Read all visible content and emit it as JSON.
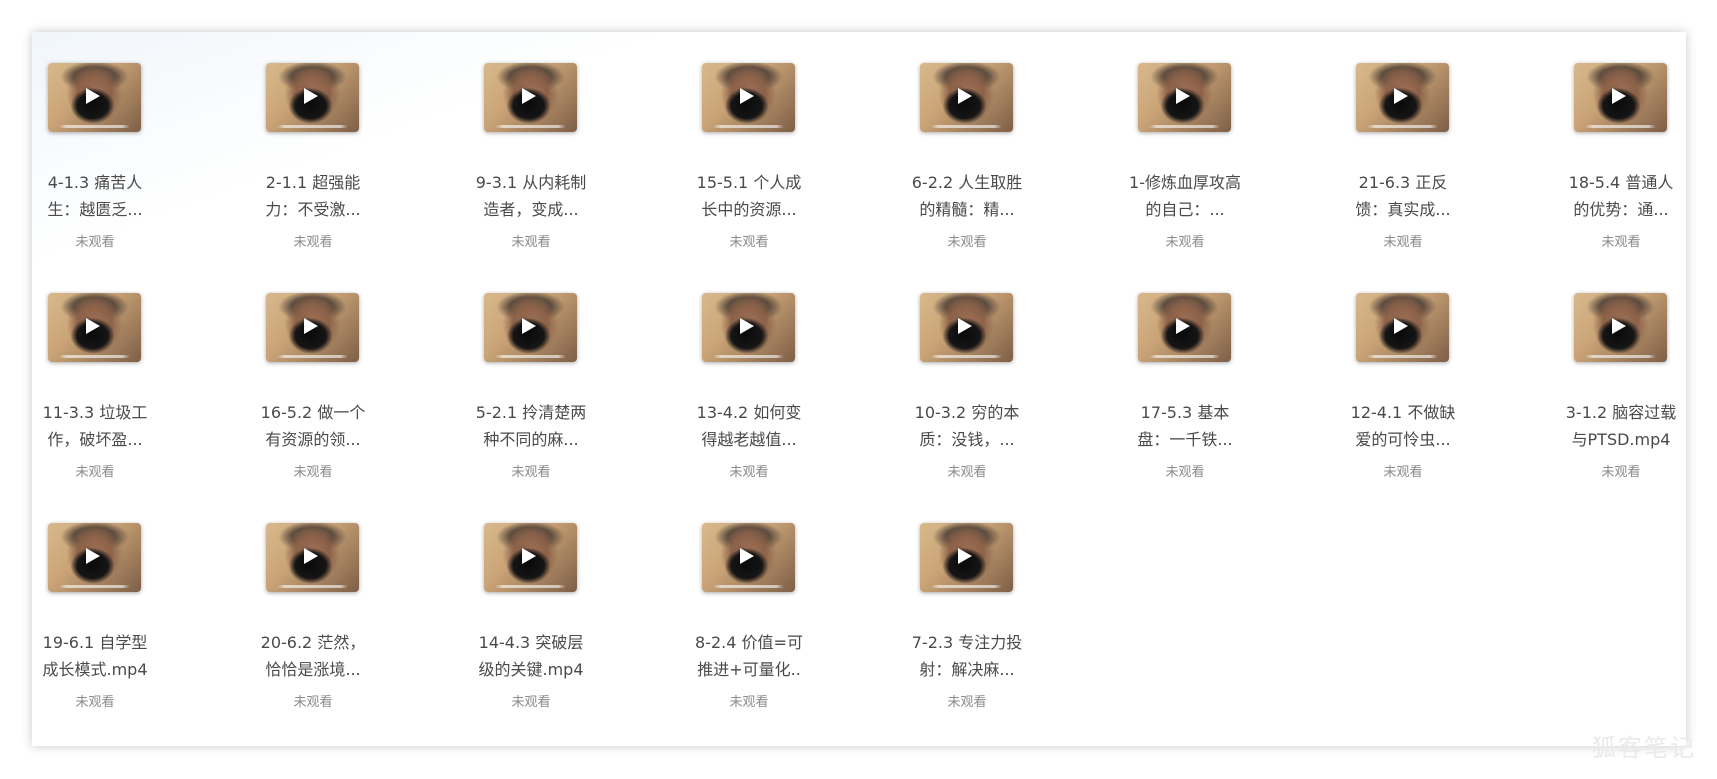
{
  "colors": {
    "title_text": "#4a4a4a",
    "status_text": "#8a8a8a",
    "panel_background": "#ffffff"
  },
  "icons": {
    "play": "play-icon"
  },
  "watermark": "狐客笔记",
  "videos": [
    {
      "title": "4-1.3 痛苦人生：越匮乏...",
      "status": "未观看"
    },
    {
      "title": "2-1.1 超强能力：不受激...",
      "status": "未观看"
    },
    {
      "title": "9-3.1 从内耗制造者，变成...",
      "status": "未观看"
    },
    {
      "title": "15-5.1 个人成长中的资源...",
      "status": "未观看"
    },
    {
      "title": "6-2.2 人生取胜的精髓：精...",
      "status": "未观看"
    },
    {
      "title": "1-修炼血厚攻高的自己：...",
      "status": "未观看"
    },
    {
      "title": "21-6.3 正反馈：真实成...",
      "status": "未观看"
    },
    {
      "title": "18-5.4 普通人的优势：通...",
      "status": "未观看"
    },
    {
      "title": "11-3.3 垃圾工作，破坏盈...",
      "status": "未观看"
    },
    {
      "title": "16-5.2 做一个有资源的领...",
      "status": "未观看"
    },
    {
      "title": "5-2.1 拎清楚两种不同的麻...",
      "status": "未观看"
    },
    {
      "title": "13-4.2 如何变得越老越值...",
      "status": "未观看"
    },
    {
      "title": "10-3.2 穷的本质：没钱，...",
      "status": "未观看"
    },
    {
      "title": "17-5.3 基本盘：一千铁...",
      "status": "未观看"
    },
    {
      "title": "12-4.1 不做缺爱的可怜虫...",
      "status": "未观看"
    },
    {
      "title": "3-1.2 脑容过载与PTSD.mp4",
      "status": "未观看"
    },
    {
      "title": "19-6.1 自学型成长模式.mp4",
      "status": "未观看"
    },
    {
      "title": "20-6.2 茫然，恰恰是涨境...",
      "status": "未观看"
    },
    {
      "title": "14-4.3 突破层级的关键.mp4",
      "status": "未观看"
    },
    {
      "title": "8-2.4 价值=可推进+可量化..",
      "status": "未观看"
    },
    {
      "title": "7-2.3 专注力投射：解决麻...",
      "status": "未观看"
    }
  ]
}
